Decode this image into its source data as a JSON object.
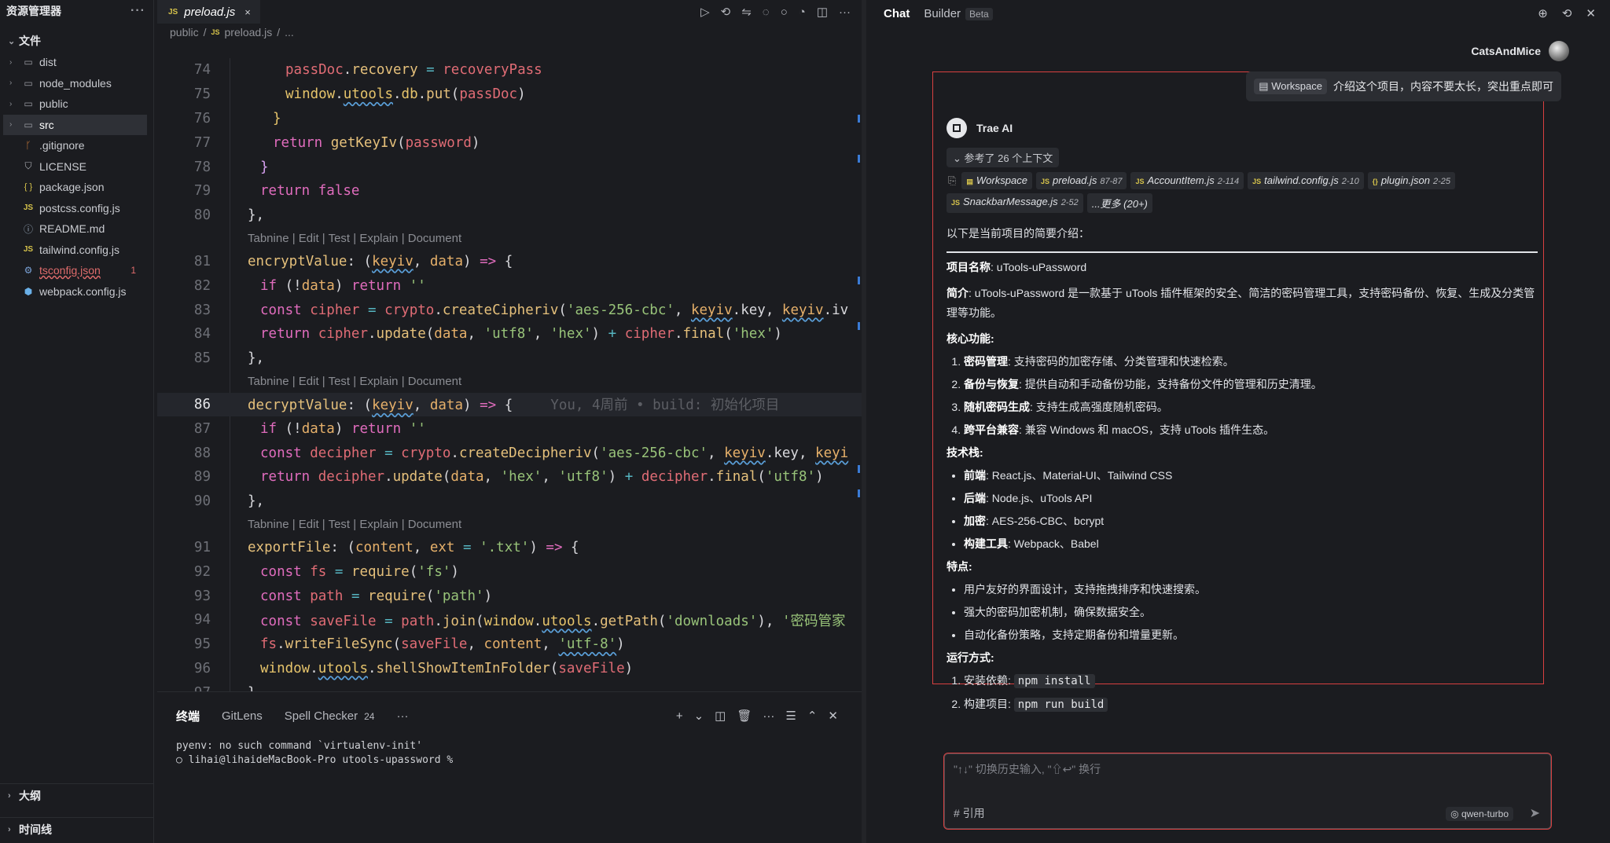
{
  "sidebar": {
    "title": "资源管理器",
    "more": "···",
    "section": "文件",
    "items": [
      {
        "name": "dist",
        "type": "folder"
      },
      {
        "name": "node_modules",
        "type": "folder"
      },
      {
        "name": "public",
        "type": "folder"
      },
      {
        "name": "src",
        "type": "folder",
        "selected": true
      },
      {
        "name": ".gitignore",
        "type": "git"
      },
      {
        "name": "LICENSE",
        "type": "license"
      },
      {
        "name": "package.json",
        "type": "json"
      },
      {
        "name": "postcss.config.js",
        "type": "js"
      },
      {
        "name": "README.md",
        "type": "md"
      },
      {
        "name": "tailwind.config.js",
        "type": "js"
      },
      {
        "name": "tsconfig.json",
        "type": "ts",
        "error": true,
        "badge": "1"
      },
      {
        "name": "webpack.config.js",
        "type": "webpack"
      }
    ],
    "outline": "大纲",
    "timeline": "时间线"
  },
  "editor": {
    "tab": {
      "icon": "JS",
      "name": "preload.js",
      "close": "×"
    },
    "breadcrumb": [
      "public",
      "/",
      "preload.js",
      "/",
      "..."
    ],
    "codelens": "Tabnine | Edit | Test | Explain | Document",
    "blame": "You, 4周前 • build: 初始化项目",
    "line_numbers": [
      "74",
      "75",
      "76",
      "77",
      "78",
      "79",
      "80",
      "81",
      "82",
      "83",
      "84",
      "85",
      "86",
      "87",
      "88",
      "89",
      "90",
      "91",
      "92",
      "93",
      "94",
      "95",
      "96",
      "97"
    ]
  },
  "panel": {
    "tabs": [
      "终端",
      "GitLens",
      "Spell Checker"
    ],
    "spell_count": "24",
    "more": "···",
    "terminal": [
      "pyenv: no such command `virtualenv-init'",
      "○ lihai@lihaideMacBook-Pro utools-upassword %"
    ]
  },
  "chat": {
    "tabs": [
      "Chat",
      "Builder"
    ],
    "beta": "Beta",
    "user": "CatsAndMice",
    "user_msg": {
      "chip": "Workspace",
      "text": "介绍这个项目，内容不要太长，突出重点即可"
    },
    "ai_name": "Trae AI",
    "context_toggle": "参考了 26 个上下文",
    "refs": [
      {
        "icon": "ws",
        "name": "Workspace",
        "range": ""
      },
      {
        "icon": "JS",
        "name": "preload.js",
        "range": "87-87"
      },
      {
        "icon": "JS",
        "name": "AccountItem.js",
        "range": "2-114"
      },
      {
        "icon": "JS",
        "name": "tailwind.config.js",
        "range": "2-10"
      },
      {
        "icon": "{}",
        "name": "plugin.json",
        "range": "2-25"
      },
      {
        "icon": "JS",
        "name": "SnackbarMessage.js",
        "range": "2-52"
      },
      {
        "icon": "",
        "name": "...更多 (20+)",
        "range": ""
      }
    ],
    "intro": "以下是当前项目的简要介绍：",
    "project_name_label": "项目名称",
    "project_name": ": uTools-uPassword",
    "brief_label": "简介",
    "brief": ": uTools-uPassword 是一款基于 uTools 插件框架的安全、简洁的密码管理工具，支持密码备份、恢复、生成及分类管理等功能。",
    "core_label": "核心功能:",
    "core": [
      {
        "b": "密码管理",
        "t": ": 支持密码的加密存储、分类管理和快速检索。"
      },
      {
        "b": "备份与恢复",
        "t": ": 提供自动和手动备份功能，支持备份文件的管理和历史清理。"
      },
      {
        "b": "随机密码生成",
        "t": ": 支持生成高强度随机密码。"
      },
      {
        "b": "跨平台兼容",
        "t": ": 兼容 Windows 和 macOS，支持 uTools 插件生态。"
      }
    ],
    "tech_label": "技术栈:",
    "tech": [
      {
        "b": "前端",
        "t": ": React.js、Material-UI、Tailwind CSS"
      },
      {
        "b": "后端",
        "t": ": Node.js、uTools API"
      },
      {
        "b": "加密",
        "t": ": AES-256-CBC、bcrypt"
      },
      {
        "b": "构建工具",
        "t": ": Webpack、Babel"
      }
    ],
    "feature_label": "特点:",
    "features": [
      "用户友好的界面设计，支持拖拽排序和快速搜索。",
      "强大的密码加密机制，确保数据安全。",
      "自动化备份策略，支持定期备份和增量更新。"
    ],
    "run_label": "运行方式:",
    "run": [
      {
        "t": "安装依赖: ",
        "code": "npm install"
      },
      {
        "t": "构建项目: ",
        "code": "npm run build"
      }
    ],
    "input_placeholder": "\"↑↓\" 切换历史输入, \"⇧↩\" 换行",
    "cite": "# 引用",
    "model": "qwen-turbo"
  }
}
